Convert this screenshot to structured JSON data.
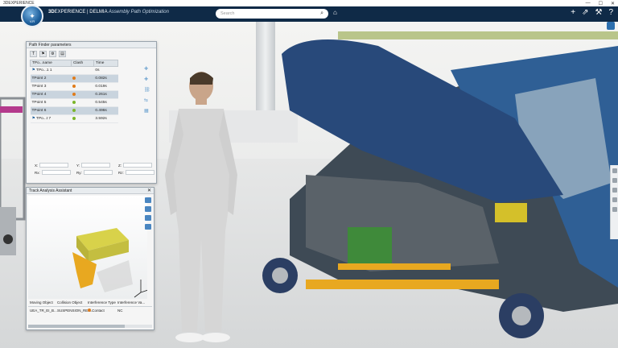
{
  "os_bar": {
    "title": "3DEXPERIENCE",
    "minimize": "—",
    "maximize": "☐",
    "close": "✕"
  },
  "header": {
    "compass_version": "V.R",
    "brand_bold": "3D",
    "brand_rest": "EXPERIENCE | DELMIA",
    "app_name": "Assembly Path Optimization",
    "search_placeholder": "Search",
    "icons": [
      "search-icon",
      "tag-icon",
      "add-icon",
      "share-icon",
      "tools-icon",
      "help-icon"
    ]
  },
  "path_finder": {
    "title": "Path Finder parameters",
    "columns": [
      "TPo...name",
      "Clash",
      "Time"
    ],
    "rows": [
      {
        "name": "TPo...1 1",
        "clash_color": "",
        "time": "0s",
        "flag": true
      },
      {
        "name": "TPoint 2",
        "clash_color": "#e07b1a",
        "time": "0.082s"
      },
      {
        "name": "TPoint 3",
        "clash_color": "#e07b1a",
        "time": "0.019s"
      },
      {
        "name": "TPoint 4",
        "clash_color": "#e07b1a",
        "time": "0.261s"
      },
      {
        "name": "TPoint 5",
        "clash_color": "#7bb52a",
        "time": "0.545s"
      },
      {
        "name": "TPoint 6",
        "clash_color": "#7bb52a",
        "time": "0.496s"
      },
      {
        "name": "TPo...t 7",
        "clash_color": "#7bb52a",
        "time": "3.592s",
        "flag": true
      }
    ],
    "coords": {
      "x": "X:",
      "y": "Y:",
      "z": "Z:",
      "rx": "Rx:",
      "ry": "Ry:",
      "rz": "Rz:"
    }
  },
  "track_assistant": {
    "title": "Track Analysis Assistant",
    "columns": [
      "Moving Object",
      "Collision Object",
      "Interference Type",
      "Interference Va..."
    ],
    "row": {
      "moving": "UEA_TR_EI_B...",
      "collision": "SUSPENSION_REL...",
      "type": "Contact",
      "value": "NC"
    }
  },
  "colors": {
    "header_bg": "#0f2a47",
    "accent": "#1c5e9b",
    "clash_orange": "#e07b1a",
    "clash_green": "#7bb52a"
  }
}
